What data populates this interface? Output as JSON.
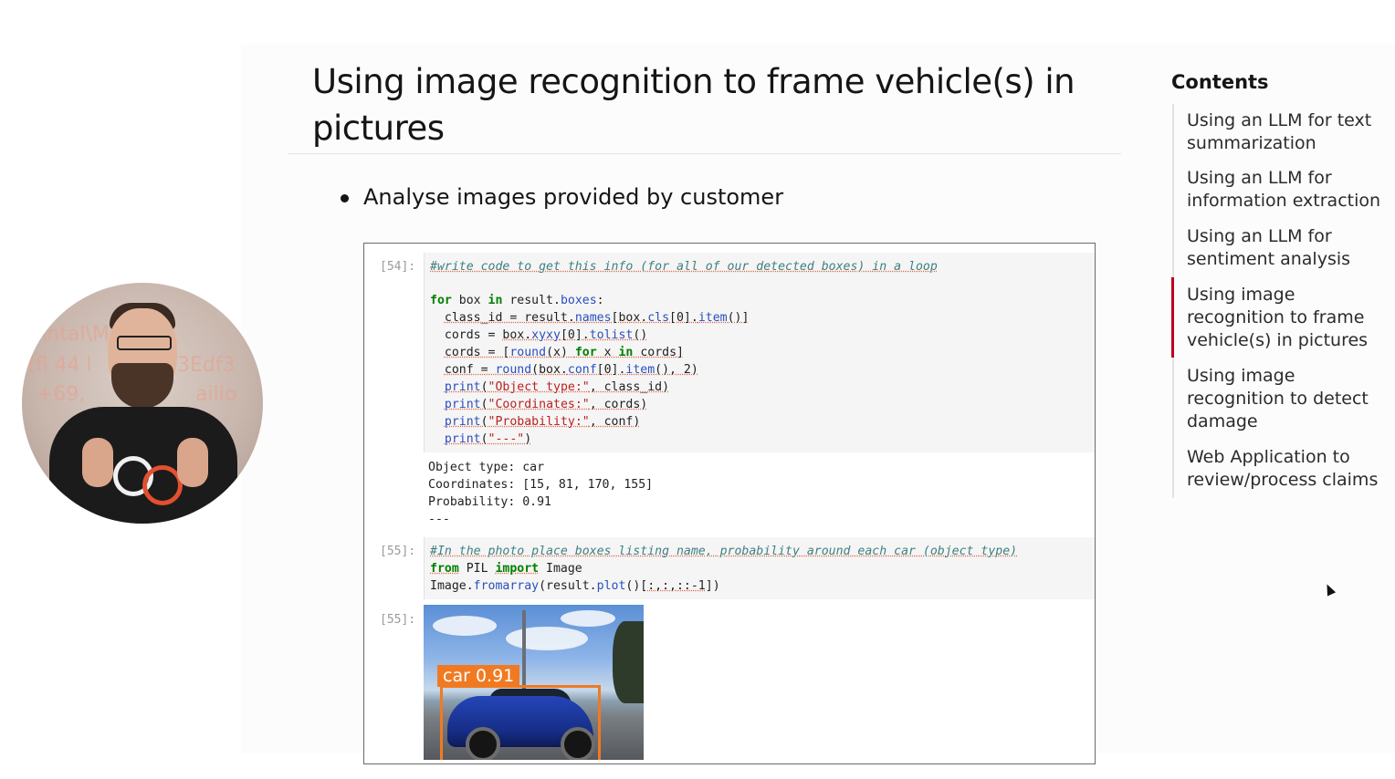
{
  "heading": "Using image recognition to frame vehicle(s) in pictures",
  "bullet": "Analyse images provided by customer",
  "notebook": {
    "cell54": {
      "prompt": "[54]:",
      "lines": [
        "#write code to get this info (for all of our detected boxes) in a loop",
        "",
        "for box in result.boxes:",
        "  class_id = result.names[box.cls[0].item()]",
        "  cords = box.xyxy[0].tolist()",
        "  cords = [round(x) for x in cords]",
        "  conf = round(box.conf[0].item(), 2)",
        "  print(\"Object type:\", class_id)",
        "  print(\"Coordinates:\", cords)",
        "  print(\"Probability:\", conf)",
        "  print(\"---\")"
      ],
      "output": [
        "Object type: car",
        "Coordinates: [15, 81, 170, 155]",
        "Probability: 0.91",
        "---"
      ]
    },
    "cell55": {
      "prompt": "[55]:",
      "lines": [
        "#In the photo place boxes listing name, probability around each car (object type)",
        "from PIL import Image",
        "Image.fromarray(result.plot()[:,:,::-1])"
      ],
      "out_prompt": "[55]:",
      "detection_label": "car 0.91"
    }
  },
  "toc": {
    "title": "Contents",
    "items": [
      "Using an LLM for text summarization",
      "Using an LLM for information extraction",
      "Using an LLM for sentiment analysis",
      "Using image recognition to frame vehicle(s) in pictures",
      "Using image recognition to detect damage",
      "Web Application to review/process claims"
    ],
    "active_index": 3
  },
  "colors": {
    "accent": "#b8001e",
    "box_orange": "#f07a22"
  }
}
